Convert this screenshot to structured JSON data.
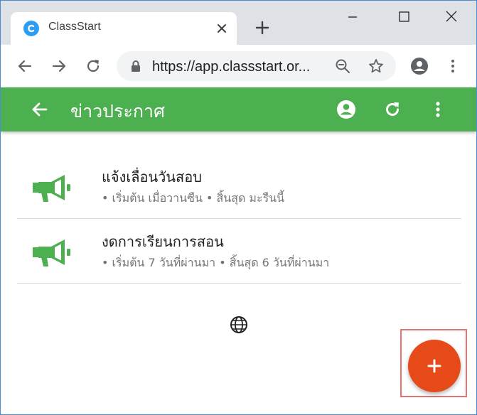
{
  "browser": {
    "tab_title": "ClassStart",
    "url": "https://app.classstart.or..."
  },
  "appbar": {
    "title": "ข่าวประกาศ"
  },
  "announcements": [
    {
      "title": "แจ้งเลื่อนวันสอบ",
      "subtitle": "• เริ่มต้น เมื่อวานซืน • สิ้นสุด มะรืนนี้"
    },
    {
      "title": "งดการเรียนการสอน",
      "subtitle": "• เริ่มต้น 7 วันที่ผ่านมา • สิ้นสุด 6 วันที่ผ่านมา"
    }
  ],
  "colors": {
    "appbar": "#4caf50",
    "fab": "#e64a19",
    "megaphone": "#4caf50"
  }
}
